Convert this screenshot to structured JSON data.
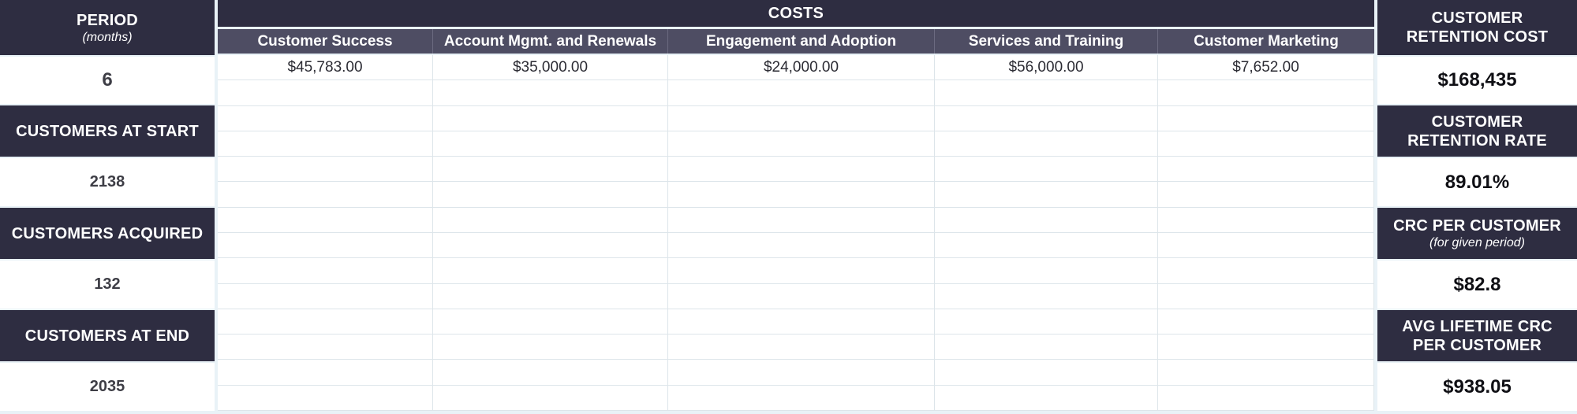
{
  "left": {
    "period_label": "PERIOD",
    "period_sub": "(months)",
    "period_value": "6",
    "start_label": "CUSTOMERS AT START",
    "start_value": "2138",
    "acquired_label": "CUSTOMERS ACQUIRED",
    "acquired_value": "132",
    "end_label": "CUSTOMERS AT END",
    "end_value": "2035"
  },
  "costs": {
    "title": "COSTS",
    "headers": [
      "Customer Success",
      "Account Mgmt. and Renewals",
      "Engagement and Adoption",
      "Services and Training",
      "Customer Marketing"
    ],
    "values": [
      "$45,783.00",
      "$35,000.00",
      "$24,000.00",
      "$56,000.00",
      "$7,652.00"
    ]
  },
  "right": {
    "retention_cost_label": "CUSTOMER RETENTION COST",
    "retention_cost_value": "$168,435",
    "retention_rate_label": "CUSTOMER RETENTION RATE",
    "retention_rate_value": "89.01%",
    "crc_label": "CRC PER CUSTOMER",
    "crc_sub": "(for given period)",
    "crc_value": "$82.8",
    "lifetime_label": "AVG LIFETIME CRC PER CUSTOMER",
    "lifetime_value": "$938.05"
  },
  "colors": {
    "header_dark": "#2e2d41",
    "header_mid": "#4e4d63",
    "background": "#e9f2f7",
    "grid_line": "#dde5ea"
  }
}
